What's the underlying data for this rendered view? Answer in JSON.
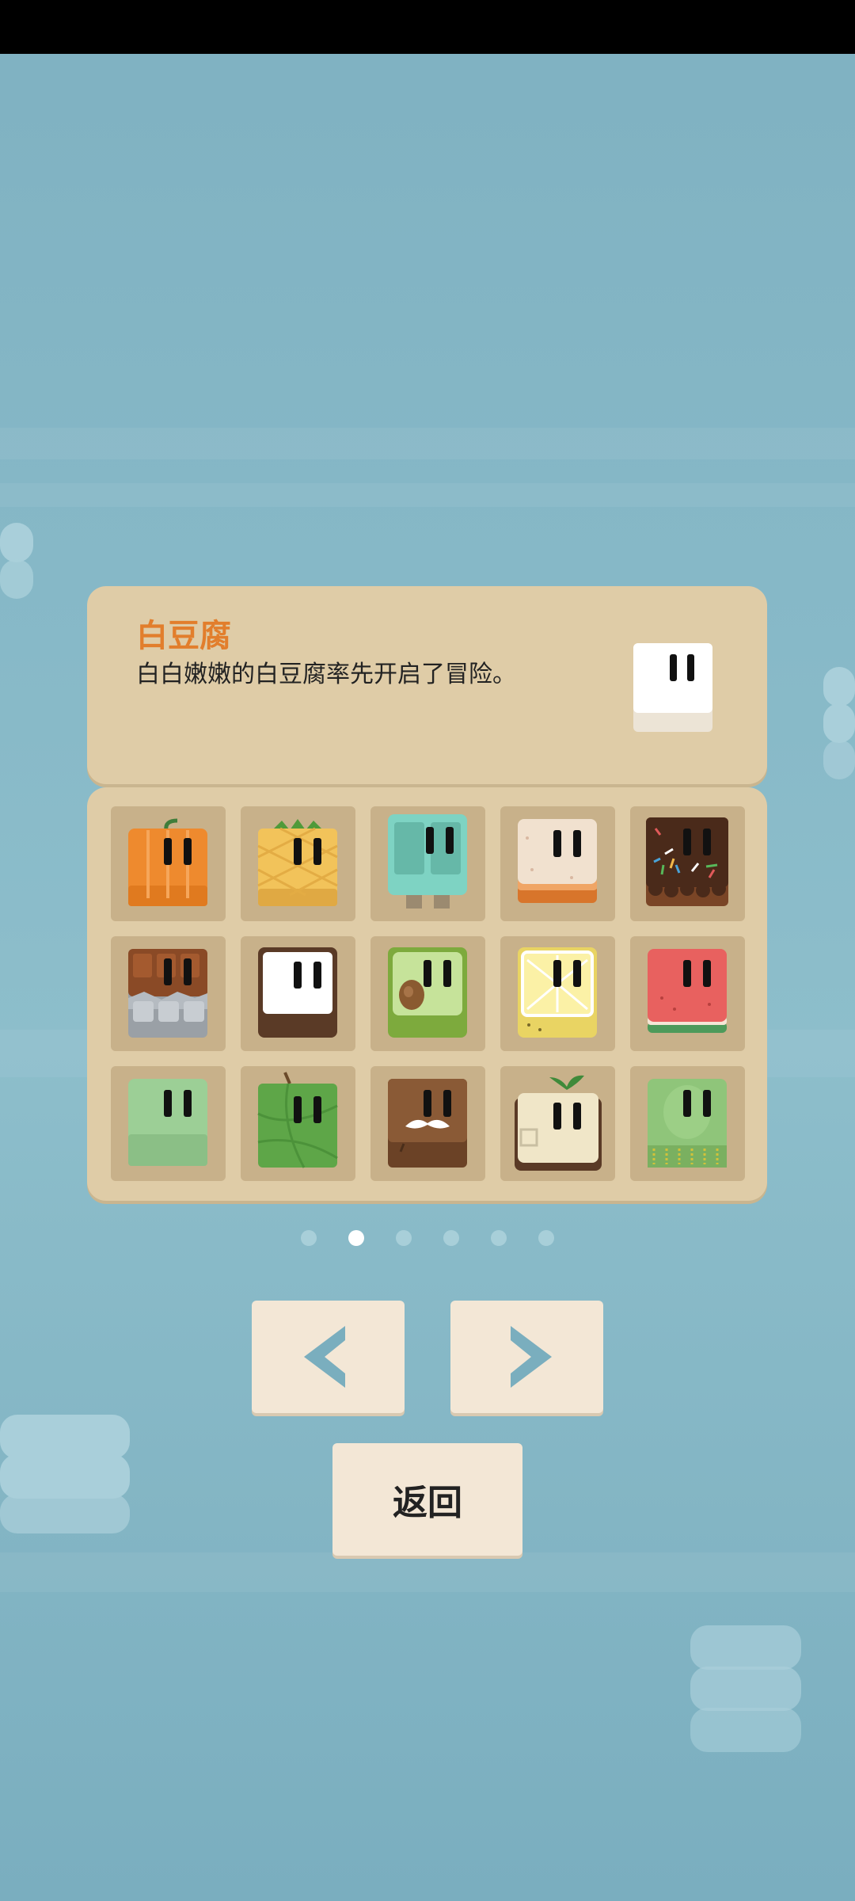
{
  "selected": {
    "name": "白豆腐",
    "description": "白白嫩嫩的白豆腐率先开启了冒险。"
  },
  "characters": [
    {
      "icon": "pumpkin-block-icon"
    },
    {
      "icon": "pineapple-block-icon"
    },
    {
      "icon": "mint-jelly-block-icon"
    },
    {
      "icon": "sandwich-block-icon"
    },
    {
      "icon": "sprinkle-cake-block-icon"
    },
    {
      "icon": "chocolate-bar-block-icon"
    },
    {
      "icon": "white-tofu-block-icon"
    },
    {
      "icon": "avocado-block-icon"
    },
    {
      "icon": "lemon-block-icon"
    },
    {
      "icon": "watermelon-block-icon"
    },
    {
      "icon": "green-jelly-block-icon"
    },
    {
      "icon": "melon-block-icon"
    },
    {
      "icon": "mustache-wood-block-icon"
    },
    {
      "icon": "sprout-tofu-block-icon"
    },
    {
      "icon": "kiwi-block-icon"
    }
  ],
  "pagination": {
    "pages": 6,
    "current": 2
  },
  "nav": {
    "prev_icon": "chevron-left-icon",
    "next_icon": "chevron-right-icon",
    "back_label": "返回"
  },
  "colors": {
    "accent_title": "#e27e2c",
    "panel": "#dfcca7",
    "button": "#f3e7d6",
    "arrow": "#7aaebe"
  }
}
